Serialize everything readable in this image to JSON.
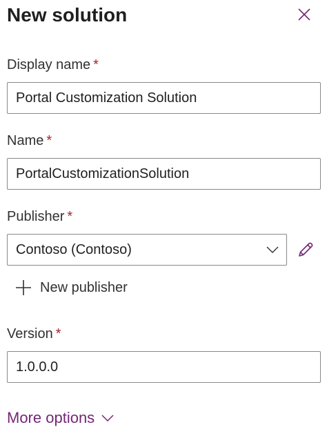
{
  "panel": {
    "title": "New solution",
    "close_icon": "close-icon"
  },
  "fields": {
    "display_name": {
      "label": "Display name",
      "required_marker": "*",
      "value": "Portal Customization Solution"
    },
    "name": {
      "label": "Name",
      "required_marker": "*",
      "value": "PortalCustomizationSolution"
    },
    "publisher": {
      "label": "Publisher",
      "required_marker": "*",
      "selected": "Contoso (Contoso)",
      "dropdown_icon": "chevron-down-icon",
      "edit_icon": "pencil-icon"
    },
    "new_publisher": {
      "label": "New publisher",
      "icon": "plus-icon"
    },
    "version": {
      "label": "Version",
      "required_marker": "*",
      "value": "1.0.0.0"
    }
  },
  "more_options": {
    "label": "More options",
    "icon": "chevron-down-icon"
  },
  "colors": {
    "accent": "#742774",
    "required": "#a4262c",
    "border": "#8a8886",
    "text": "#201f1e"
  }
}
